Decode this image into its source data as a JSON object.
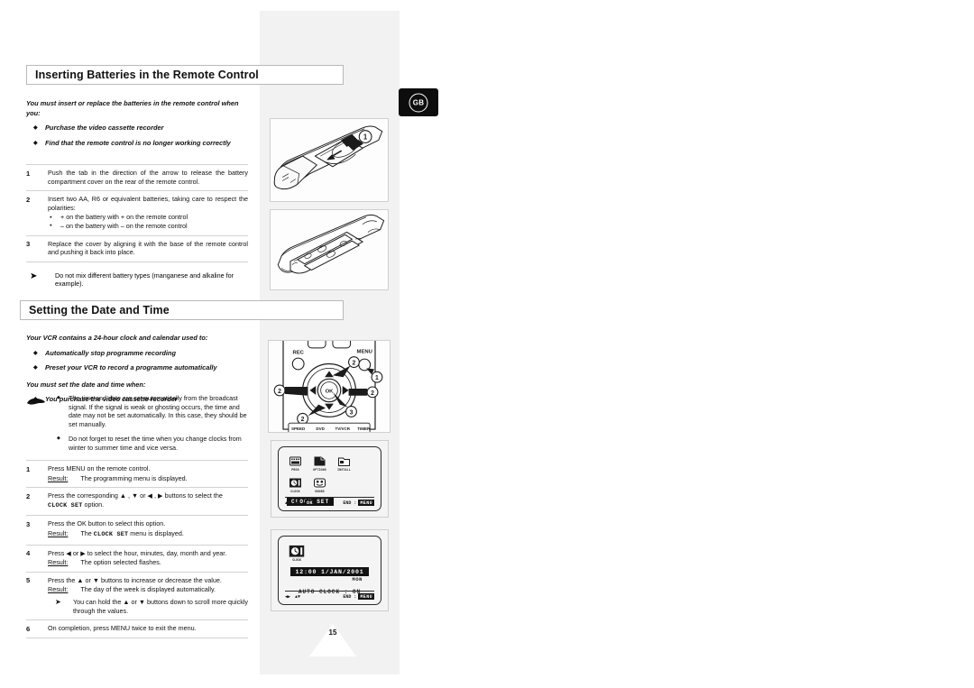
{
  "page": {
    "number": "15",
    "region_badge": "GB"
  },
  "sections": [
    {
      "id": "batteries",
      "title": "Inserting Batteries in the Remote Control",
      "intro": "You must insert or replace the batteries in the remote control when you:",
      "intro_bullets": [
        "Purchase the video cassette recorder",
        "Find that the remote control is no longer working correctly"
      ],
      "steps": [
        {
          "num": "1",
          "text": "Push the tab in the direction of the arrow to release the battery compartment cover on the rear of the remote control.",
          "sub": []
        },
        {
          "num": "2",
          "text": "Insert two AA, R6 or equivalent batteries, taking care to respect the polarities:",
          "sub": [
            "+ on the battery with + on the remote control",
            "– on the battery with – on the remote control"
          ]
        },
        {
          "num": "3",
          "text": "Replace the cover by aligning it with the base of the remote control and pushing it back into place.",
          "sub": []
        }
      ],
      "note": "Do not mix different battery types (manganese and alkaline for example).",
      "note_marker": "➤"
    },
    {
      "id": "datetime",
      "title": "Setting the Date and Time",
      "intro": "Your VCR contains a 24-hour clock and calendar used to:",
      "intro_bullets": [
        "Automatically stop programme recording",
        "Preset your VCR to record a programme automatically"
      ],
      "intro2": "You must set the date and time when:",
      "intro2_bullets": [
        "You purchase the video cassette recorder"
      ],
      "hand_notes": [
        "The time and date are set automatically from the broadcast signal. If the signal is weak or ghosting occurs, the time and date may not be set automatically. In this case, they should be set manually.",
        "Do not forget to reset the time when you change clocks from winter to summer time and vice versa."
      ],
      "steps": [
        {
          "num": "1",
          "text": "Press MENU on the remote control.",
          "result_label": "Result:",
          "result": "The programming menu is displayed."
        },
        {
          "num": "2",
          "text_pre": "Press the corresponding",
          "arrows": "▲ , ▼ or ◀ , ▶",
          "text_post": "buttons to select the",
          "mono": "CLOCK SET",
          "text_end": "option."
        },
        {
          "num": "3",
          "text": "Press the OK button to select this option.",
          "result_label": "Result:",
          "result_pre": "The",
          "result_mono": "CLOCK SET",
          "result_post": "menu is displayed."
        },
        {
          "num": "4",
          "text": "Press ◀ or ▶ to select the hour, minutes, day, month and year.",
          "result_label": "Result:",
          "result": "The option selected flashes."
        },
        {
          "num": "5",
          "text": "Press the ▲ or ▼ buttons to increase or decrease the value.",
          "result_label": "Result:",
          "result": "The day of the week is displayed automatically.",
          "tip_marker": "➤",
          "tip": "You can hold the ▲ or ▼ buttons down to scroll more quickly through the values."
        },
        {
          "num": "6",
          "text": "On completion, press MENU twice to exit the menu."
        }
      ]
    }
  ],
  "figures": {
    "remote_battery_open": {
      "caption": "",
      "callouts": [
        "1"
      ]
    },
    "remote_battery_inserted": {
      "caption": "",
      "callouts": []
    },
    "keypad": {
      "rec_label": "REC",
      "menu_label": "MENU",
      "ok_label": "OK",
      "callouts": [
        "1",
        "2",
        "2",
        "2",
        "2",
        "3",
        "3"
      ],
      "bottom_buttons": [
        "SPEED",
        "DVD",
        "TV/VCR",
        "TIMER"
      ]
    },
    "osd_menu": {
      "icons_row1": [
        "PROG",
        "OPTIONS",
        "INSTALL"
      ],
      "icons_row2": [
        "CLOCK",
        "SOUND"
      ],
      "selected": "CLOCK  SET",
      "footer_left_nav": "▲▼",
      "footer_left_nav2": "◀▶",
      "footer_left_chip": "OK",
      "footer_right_label": "END :",
      "footer_right_chip": "MENU"
    },
    "osd_clock": {
      "icon_label": "CLOCK",
      "time_date": "12:00   1/JAN/2001",
      "weekday": "MON",
      "auto_clock": "AUTO CLOCK : ON",
      "footer_left_nav": "◀▶",
      "footer_left_nav2": "▲▼",
      "footer_right_label": "END :",
      "footer_right_chip": "MENU"
    }
  },
  "colors": {
    "panel_gray": "#f2f2f2",
    "ink": "#111111",
    "rule": "#d2d2d2",
    "badge_bg": "#0d0d0d"
  }
}
